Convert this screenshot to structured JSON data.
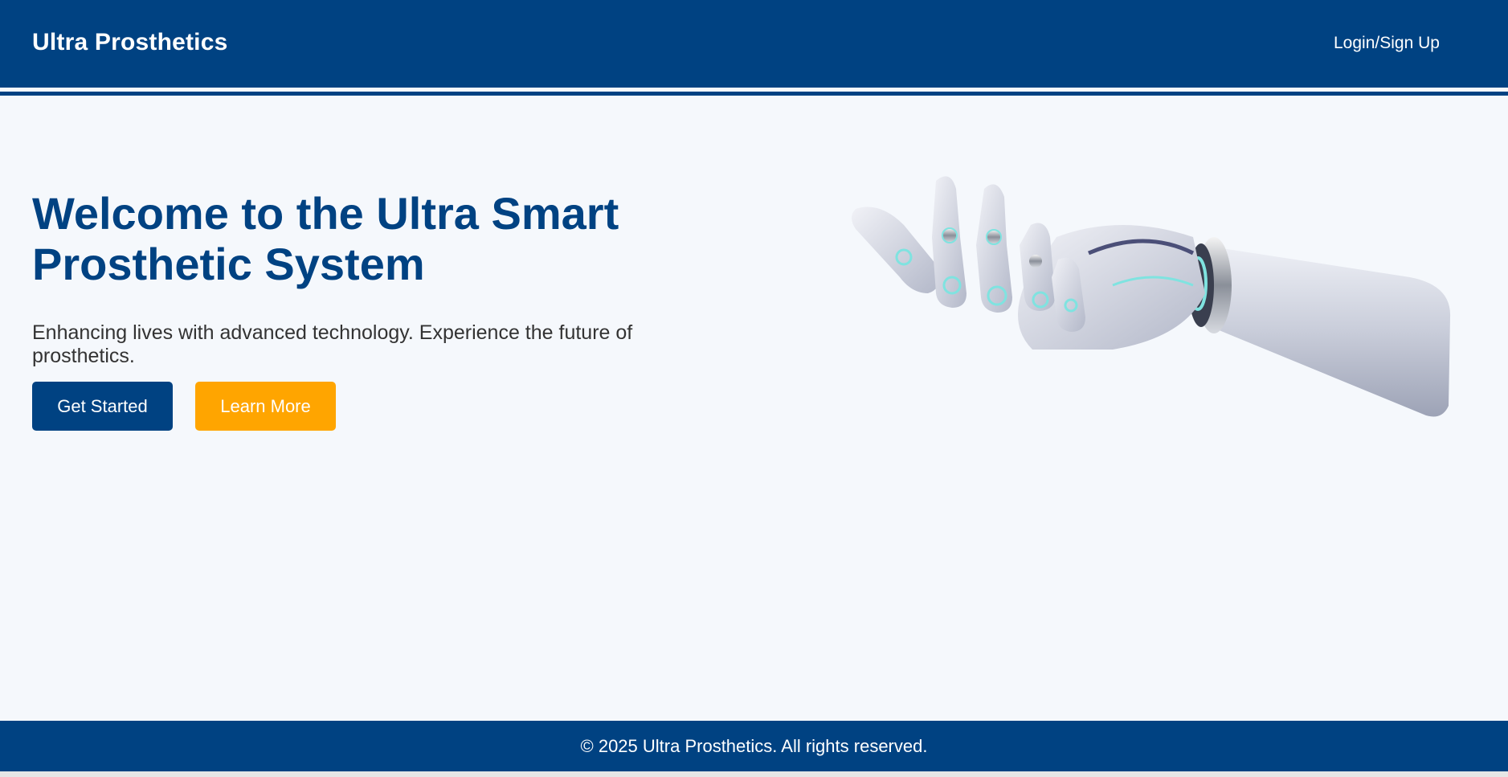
{
  "header": {
    "brand": "Ultra Prosthetics",
    "login_label": "Login/Sign Up"
  },
  "hero": {
    "title": "Welcome to the Ultra Smart Prosthetic System",
    "subtitle": "Enhancing lives with advanced technology. Experience the future of prosthetics.",
    "primary_button": "Get Started",
    "secondary_button": "Learn More",
    "image_icon": "robotic-hand-icon"
  },
  "footer": {
    "copyright": "© 2025 Ultra Prosthetics. All rights reserved."
  },
  "colors": {
    "brand_blue": "#004282",
    "accent_orange": "#ffa500",
    "page_background": "#f5f8fc"
  }
}
